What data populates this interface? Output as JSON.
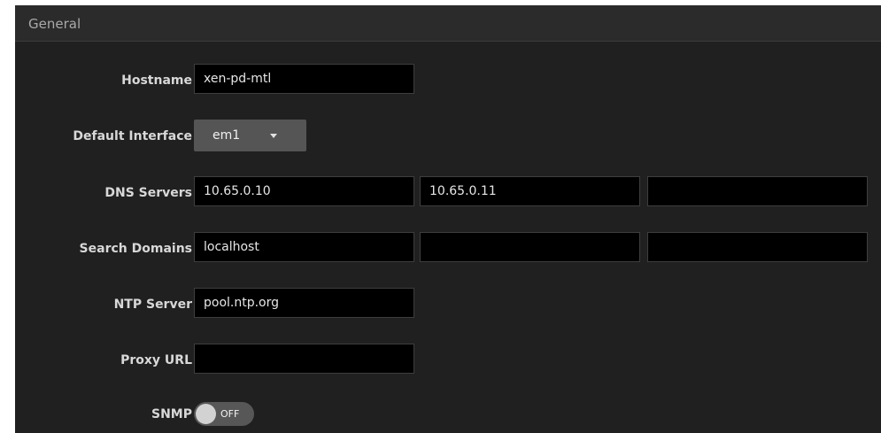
{
  "section": {
    "title": "General"
  },
  "hostname": {
    "label": "Hostname",
    "value": "xen-pd-mtl"
  },
  "default_interface": {
    "label": "Default Interface",
    "value": "em1"
  },
  "dns_servers": {
    "label": "DNS Servers",
    "values": [
      "10.65.0.10",
      "10.65.0.11",
      ""
    ]
  },
  "search_domains": {
    "label": "Search Domains",
    "values": [
      "localhost",
      "",
      ""
    ]
  },
  "ntp_server": {
    "label": "NTP Server",
    "value": "pool.ntp.org"
  },
  "proxy_url": {
    "label": "Proxy URL",
    "value": ""
  },
  "snmp": {
    "label": "SNMP",
    "state": "OFF",
    "enabled": false
  },
  "colors": {
    "panel_bg": "#202020",
    "header_bg": "#2b2b2b",
    "input_bg": "#000000",
    "dropdown_bg": "#555555",
    "toggle_off_bg": "#575757"
  },
  "icons": {
    "dropdown": "caret-down-icon",
    "toggle": "toggle-knob"
  }
}
